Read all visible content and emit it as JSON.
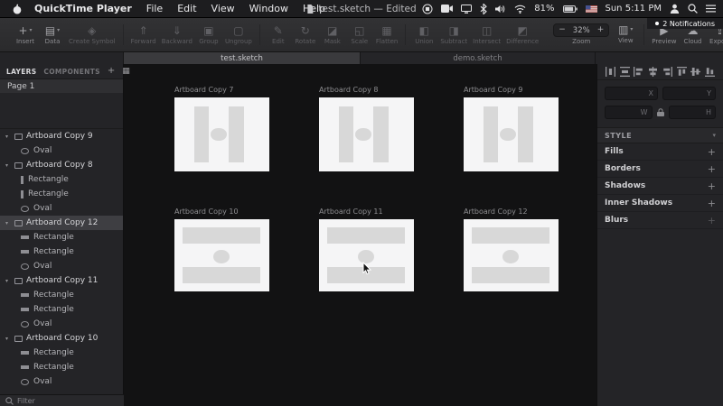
{
  "icons": {
    "disclosure": "▾",
    "plus": "+",
    "grid": "▦",
    "chevron": "▾"
  },
  "menu_bar": {
    "app_name": "QuickTime Player",
    "menus": [
      "File",
      "Edit",
      "View",
      "Window",
      "Help"
    ],
    "document_title": "test.sketch — Edited",
    "battery_percent": "81%",
    "clock": "Sun 5:11 PM",
    "notification_badge": "2 Notifications"
  },
  "toolbar": {
    "groups": [
      {
        "items": [
          {
            "label": "Insert",
            "glyph": "+",
            "caret": "▾"
          },
          {
            "label": "Data",
            "glyph": "▤",
            "caret": "▾"
          },
          {
            "label": "Create Symbol",
            "glyph": "◈"
          }
        ]
      },
      {
        "items": [
          {
            "label": "Forward",
            "glyph": "⇑"
          },
          {
            "label": "Backward",
            "glyph": "⇓"
          },
          {
            "label": "Group",
            "glyph": "▣"
          },
          {
            "label": "Ungroup",
            "glyph": "▢"
          }
        ]
      },
      {
        "items": [
          {
            "label": "Edit",
            "glyph": "✎"
          },
          {
            "label": "Rotate",
            "glyph": "↻"
          },
          {
            "label": "Mask",
            "glyph": "◪"
          },
          {
            "label": "Scale",
            "glyph": "◱"
          },
          {
            "label": "Flatten",
            "glyph": "▦"
          }
        ]
      },
      {
        "items": [
          {
            "label": "Union",
            "glyph": "◧"
          },
          {
            "label": "Subtract",
            "glyph": "◨"
          },
          {
            "label": "Intersect",
            "glyph": "◫"
          },
          {
            "label": "Difference",
            "glyph": "◩"
          }
        ]
      }
    ],
    "zoom": {
      "minus": "−",
      "value": "32%",
      "plus": "+",
      "label": "Zoom"
    },
    "view": {
      "glyph": "▥",
      "caret": "▾",
      "label": "View"
    },
    "right_items": [
      {
        "label": "Preview",
        "glyph": "▶"
      },
      {
        "label": "Cloud",
        "glyph": "☁"
      },
      {
        "label": "Export",
        "glyph": "⇪"
      }
    ]
  },
  "tab_bar": {
    "tabs": [
      {
        "label": "test.sketch",
        "active": true
      },
      {
        "label": "demo.sketch",
        "active": false
      }
    ]
  },
  "sidebar": {
    "tabs": [
      {
        "label": "LAYERS",
        "active": true
      },
      {
        "label": "COMPONENTS",
        "active": false
      }
    ],
    "page_item": "Page 1",
    "layers": [
      {
        "name": "Artboard Copy 9",
        "type": "artboard"
      },
      {
        "name": "Oval",
        "type": "oval"
      },
      {
        "name": "Artboard Copy 8",
        "type": "artboard"
      },
      {
        "name": "Rectangle",
        "type": "rect-v"
      },
      {
        "name": "Rectangle",
        "type": "rect-v"
      },
      {
        "name": "Oval",
        "type": "oval"
      },
      {
        "name": "Artboard Copy 12",
        "type": "artboard",
        "selected": true
      },
      {
        "name": "Rectangle",
        "type": "rect-h"
      },
      {
        "name": "Rectangle",
        "type": "rect-h"
      },
      {
        "name": "Oval",
        "type": "oval"
      },
      {
        "name": "Artboard Copy 11",
        "type": "artboard"
      },
      {
        "name": "Rectangle",
        "type": "rect-h"
      },
      {
        "name": "Rectangle",
        "type": "rect-h"
      },
      {
        "name": "Oval",
        "type": "oval"
      },
      {
        "name": "Artboard Copy 10",
        "type": "artboard"
      },
      {
        "name": "Rectangle",
        "type": "rect-h"
      },
      {
        "name": "Rectangle",
        "type": "rect-h"
      },
      {
        "name": "Oval",
        "type": "oval"
      }
    ],
    "filter_label": "Filter"
  },
  "canvas": {
    "artboards": [
      {
        "title": "Artboard Copy 7",
        "layout": "vertical"
      },
      {
        "title": "Artboard Copy 8",
        "layout": "vertical"
      },
      {
        "title": "Artboard Copy 9",
        "layout": "vertical"
      },
      {
        "title": "Artboard Copy 10",
        "layout": "horizontal"
      },
      {
        "title": "Artboard Copy 11",
        "layout": "horizontal"
      },
      {
        "title": "Artboard Copy 12",
        "layout": "horizontal"
      }
    ]
  },
  "inspector": {
    "fields": [
      {
        "label": "X",
        "value": ""
      },
      {
        "label": "Y",
        "value": ""
      },
      {
        "label": "W",
        "value": ""
      },
      {
        "label": "H",
        "value": ""
      }
    ],
    "style_header": "STYLE",
    "sections": [
      {
        "label": "Fills",
        "add": "+"
      },
      {
        "label": "Borders",
        "add": "+"
      },
      {
        "label": "Shadows",
        "add": "+"
      },
      {
        "label": "Inner Shadows",
        "add": "+"
      },
      {
        "label": "Blurs",
        "add": "+",
        "dimmed": true
      }
    ]
  }
}
